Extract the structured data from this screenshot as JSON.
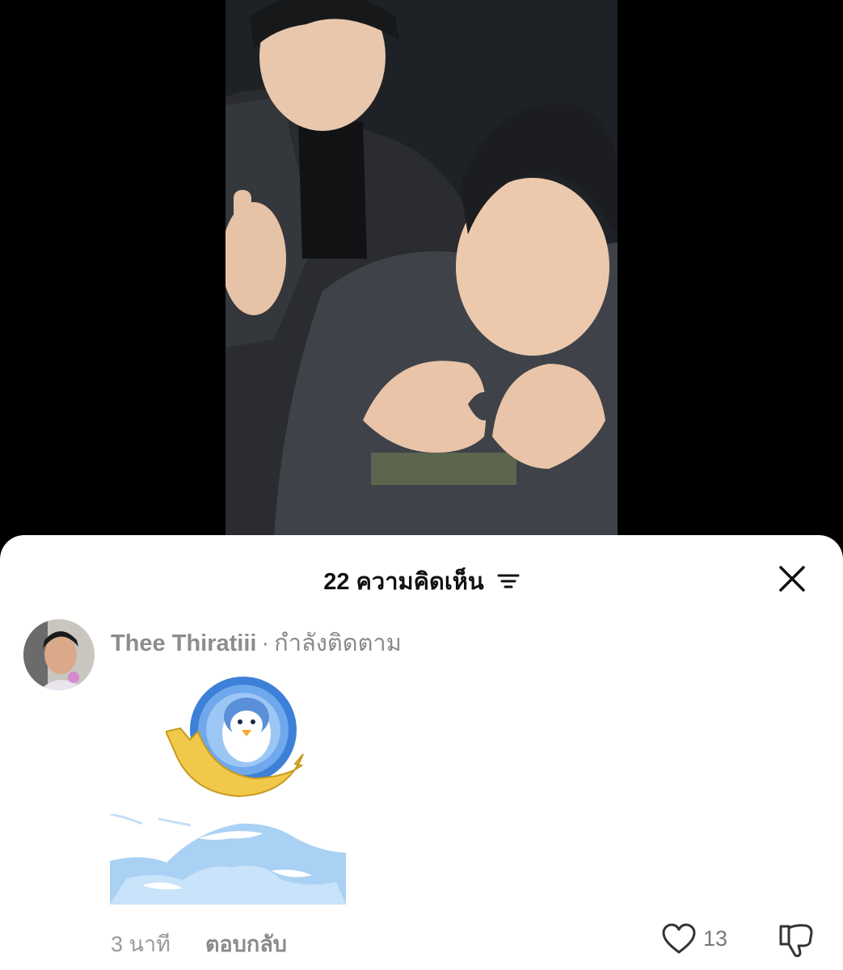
{
  "video": {
    "frame_color": "#1f2226"
  },
  "comments_sheet": {
    "count_label": "22 ความคิดเห็น",
    "sort_icon": "sort-filter-icon",
    "close_icon": "close-icon"
  },
  "comment": {
    "author": "Thee Thiratiii",
    "separator": "·",
    "status": "กำลังติดตาม",
    "time": "3 นาที",
    "reply_label": "ตอบกลับ",
    "like_count": "13",
    "stickers": [
      "penguin-coin-sticker",
      "wave-sticker"
    ]
  },
  "colors": {
    "sheet_bg": "#ffffff",
    "muted_text": "#8a8a8a",
    "title_text": "#111111",
    "coin_blue": "#3f86e0",
    "shell_yellow": "#f0c94a"
  }
}
